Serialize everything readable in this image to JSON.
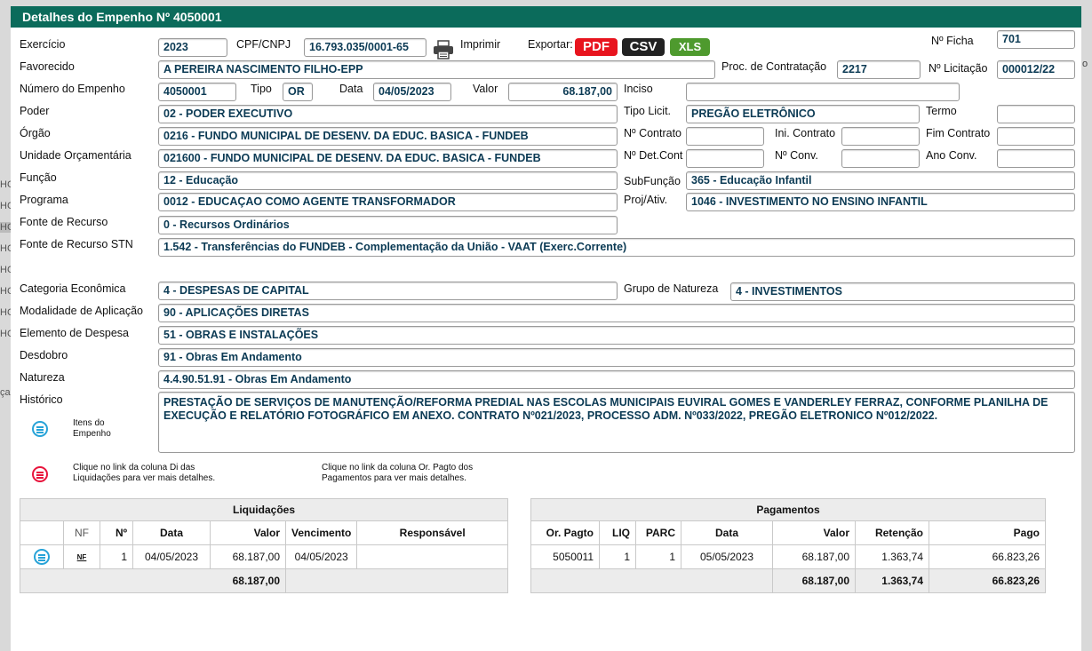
{
  "background": {
    "side_labels": [
      "HC",
      "HC",
      "HC",
      "HC",
      "HC",
      "HC",
      "HC",
      "HC"
    ],
    "side_label_ca": "ça",
    "side_label_o": "o"
  },
  "title": "Detalhes do Empenho Nº 4050001",
  "labels": {
    "exercicio": "Exercício",
    "cpf": "CPF/CNPJ",
    "imprimir": "Imprimir",
    "exportar": "Exportar:",
    "ficha": "Nº Ficha",
    "favorecido": "Favorecido",
    "proc": "Proc. de Contratação",
    "licitacao": "Nº Licitação",
    "numero": "Número do Empenho",
    "tipo": "Tipo",
    "data": "Data",
    "valor": "Valor",
    "inciso": "Inciso",
    "poder": "Poder",
    "tipolicit": "Tipo Licit.",
    "termo": "Termo",
    "orgao": "Órgão",
    "ncontrato": "Nº Contrato",
    "inicontrato": "Ini. Contrato",
    "fimcontrato": "Fim Contrato",
    "unidade": "Unidade Orçamentária",
    "ndetcont": "Nº Det.Cont",
    "nconv": "Nº Conv.",
    "anoconv": "Ano Conv.",
    "funcao": "Função",
    "subfuncao": "SubFunção",
    "programa": "Programa",
    "projativ": "Proj/Ativ.",
    "fonte": "Fonte de Recurso",
    "fontestn": "Fonte de Recurso STN",
    "categoria": "Categoria Econômica",
    "grupo": "Grupo de Natureza",
    "modalidade": "Modalidade de Aplicação",
    "elemento": "Elemento de Despesa",
    "desdobro": "Desdobro",
    "natureza": "Natureza",
    "historico": "Histórico"
  },
  "export": {
    "pdf": "PDF",
    "csv": "CSV",
    "xls": "XLS",
    "pdf_color": "#e8141e",
    "csv_color": "#222222",
    "xls_color": "#4e9a2e"
  },
  "fields": {
    "exercicio": "2023",
    "cpf": "16.793.035/0001-65",
    "ficha": "701",
    "favorecido": "A PEREIRA NASCIMENTO FILHO-EPP",
    "proc": "2217",
    "licitacao": "000012/22",
    "numero": "4050001",
    "tipo": "OR",
    "data": "04/05/2023",
    "valor": "68.187,00",
    "inciso": "",
    "poder": "02 - PODER EXECUTIVO",
    "tipolicit": "PREGÃO ELETRÔNICO",
    "termo": "",
    "orgao": "0216 - FUNDO MUNICIPAL DE DESENV. DA EDUC. BASICA - FUNDEB",
    "ncontrato": "",
    "inicontrato": "",
    "fimcontrato": "",
    "unidade": "021600 - FUNDO MUNICIPAL DE DESENV. DA EDUC. BASICA - FUNDEB",
    "ndetcont": "",
    "nconv": "",
    "anoconv": "",
    "funcao": "12 - Educação",
    "subfuncao": "365 - Educação Infantil",
    "programa": "0012 - EDUCAÇAO COMO AGENTE TRANSFORMADOR",
    "projativ": "1046 - INVESTIMENTO NO ENSINO INFANTIL",
    "fonte": "0 - Recursos Ordinários",
    "fontestn": "1.542 - Transferências do FUNDEB - Complementação da União - VAAT (Exerc.Corrente)",
    "categoria": "4 - DESPESAS DE CAPITAL",
    "grupo": "4 - INVESTIMENTOS",
    "modalidade": "90 - APLICAÇÕES DIRETAS",
    "elemento": "51 - OBRAS E INSTALAÇÕES",
    "desdobro": "91 - Obras Em Andamento",
    "natureza": "4.4.90.51.91 - Obras Em Andamento",
    "historico": "PRESTAÇÃO DE SERVIÇOS DE MANUTENÇÃO/REFORMA PREDIAL NAS ESCOLAS MUNICIPAIS EUVIRAL GOMES E VANDERLEY FERRAZ, CONFORME PLANILHA DE EXECUÇÃO E RELATÓRIO FOTOGRÁFICO EM ANEXO. CONTRATO Nº021/2023, PROCESSO ADM. Nº033/2022, PREGÃO ELETRONICO Nº012/2022."
  },
  "itens": {
    "line1": "Itens do",
    "line2": "Empenho"
  },
  "notes": {
    "liq1": "Clique no link da coluna Di das",
    "liq2": "Liquidações para ver mais detalhes.",
    "pag1": "Clique no link da coluna Or. Pagto dos",
    "pag2": "Pagamentos para ver mais detalhes."
  },
  "liquidacoes": {
    "caption": "Liquidações",
    "headers": [
      "NF",
      "Nº",
      "Data",
      "Valor",
      "Vencimento",
      "Responsável"
    ],
    "row": {
      "nf": "NF",
      "n": "1",
      "data": "04/05/2023",
      "valor": "68.187,00",
      "venc": "04/05/2023",
      "resp": ""
    },
    "total": "68.187,00"
  },
  "pagamentos": {
    "caption": "Pagamentos",
    "headers": [
      "Or. Pagto",
      "LIQ",
      "PARC",
      "Data",
      "Valor",
      "Retenção",
      "Pago"
    ],
    "row": {
      "or": "5050011",
      "liq": "1",
      "parc": "1",
      "data": "05/05/2023",
      "valor": "68.187,00",
      "ret": "1.363,74",
      "pago": "66.823,26"
    },
    "totals": {
      "valor": "68.187,00",
      "ret": "1.363,74",
      "pago": "66.823,26"
    }
  }
}
